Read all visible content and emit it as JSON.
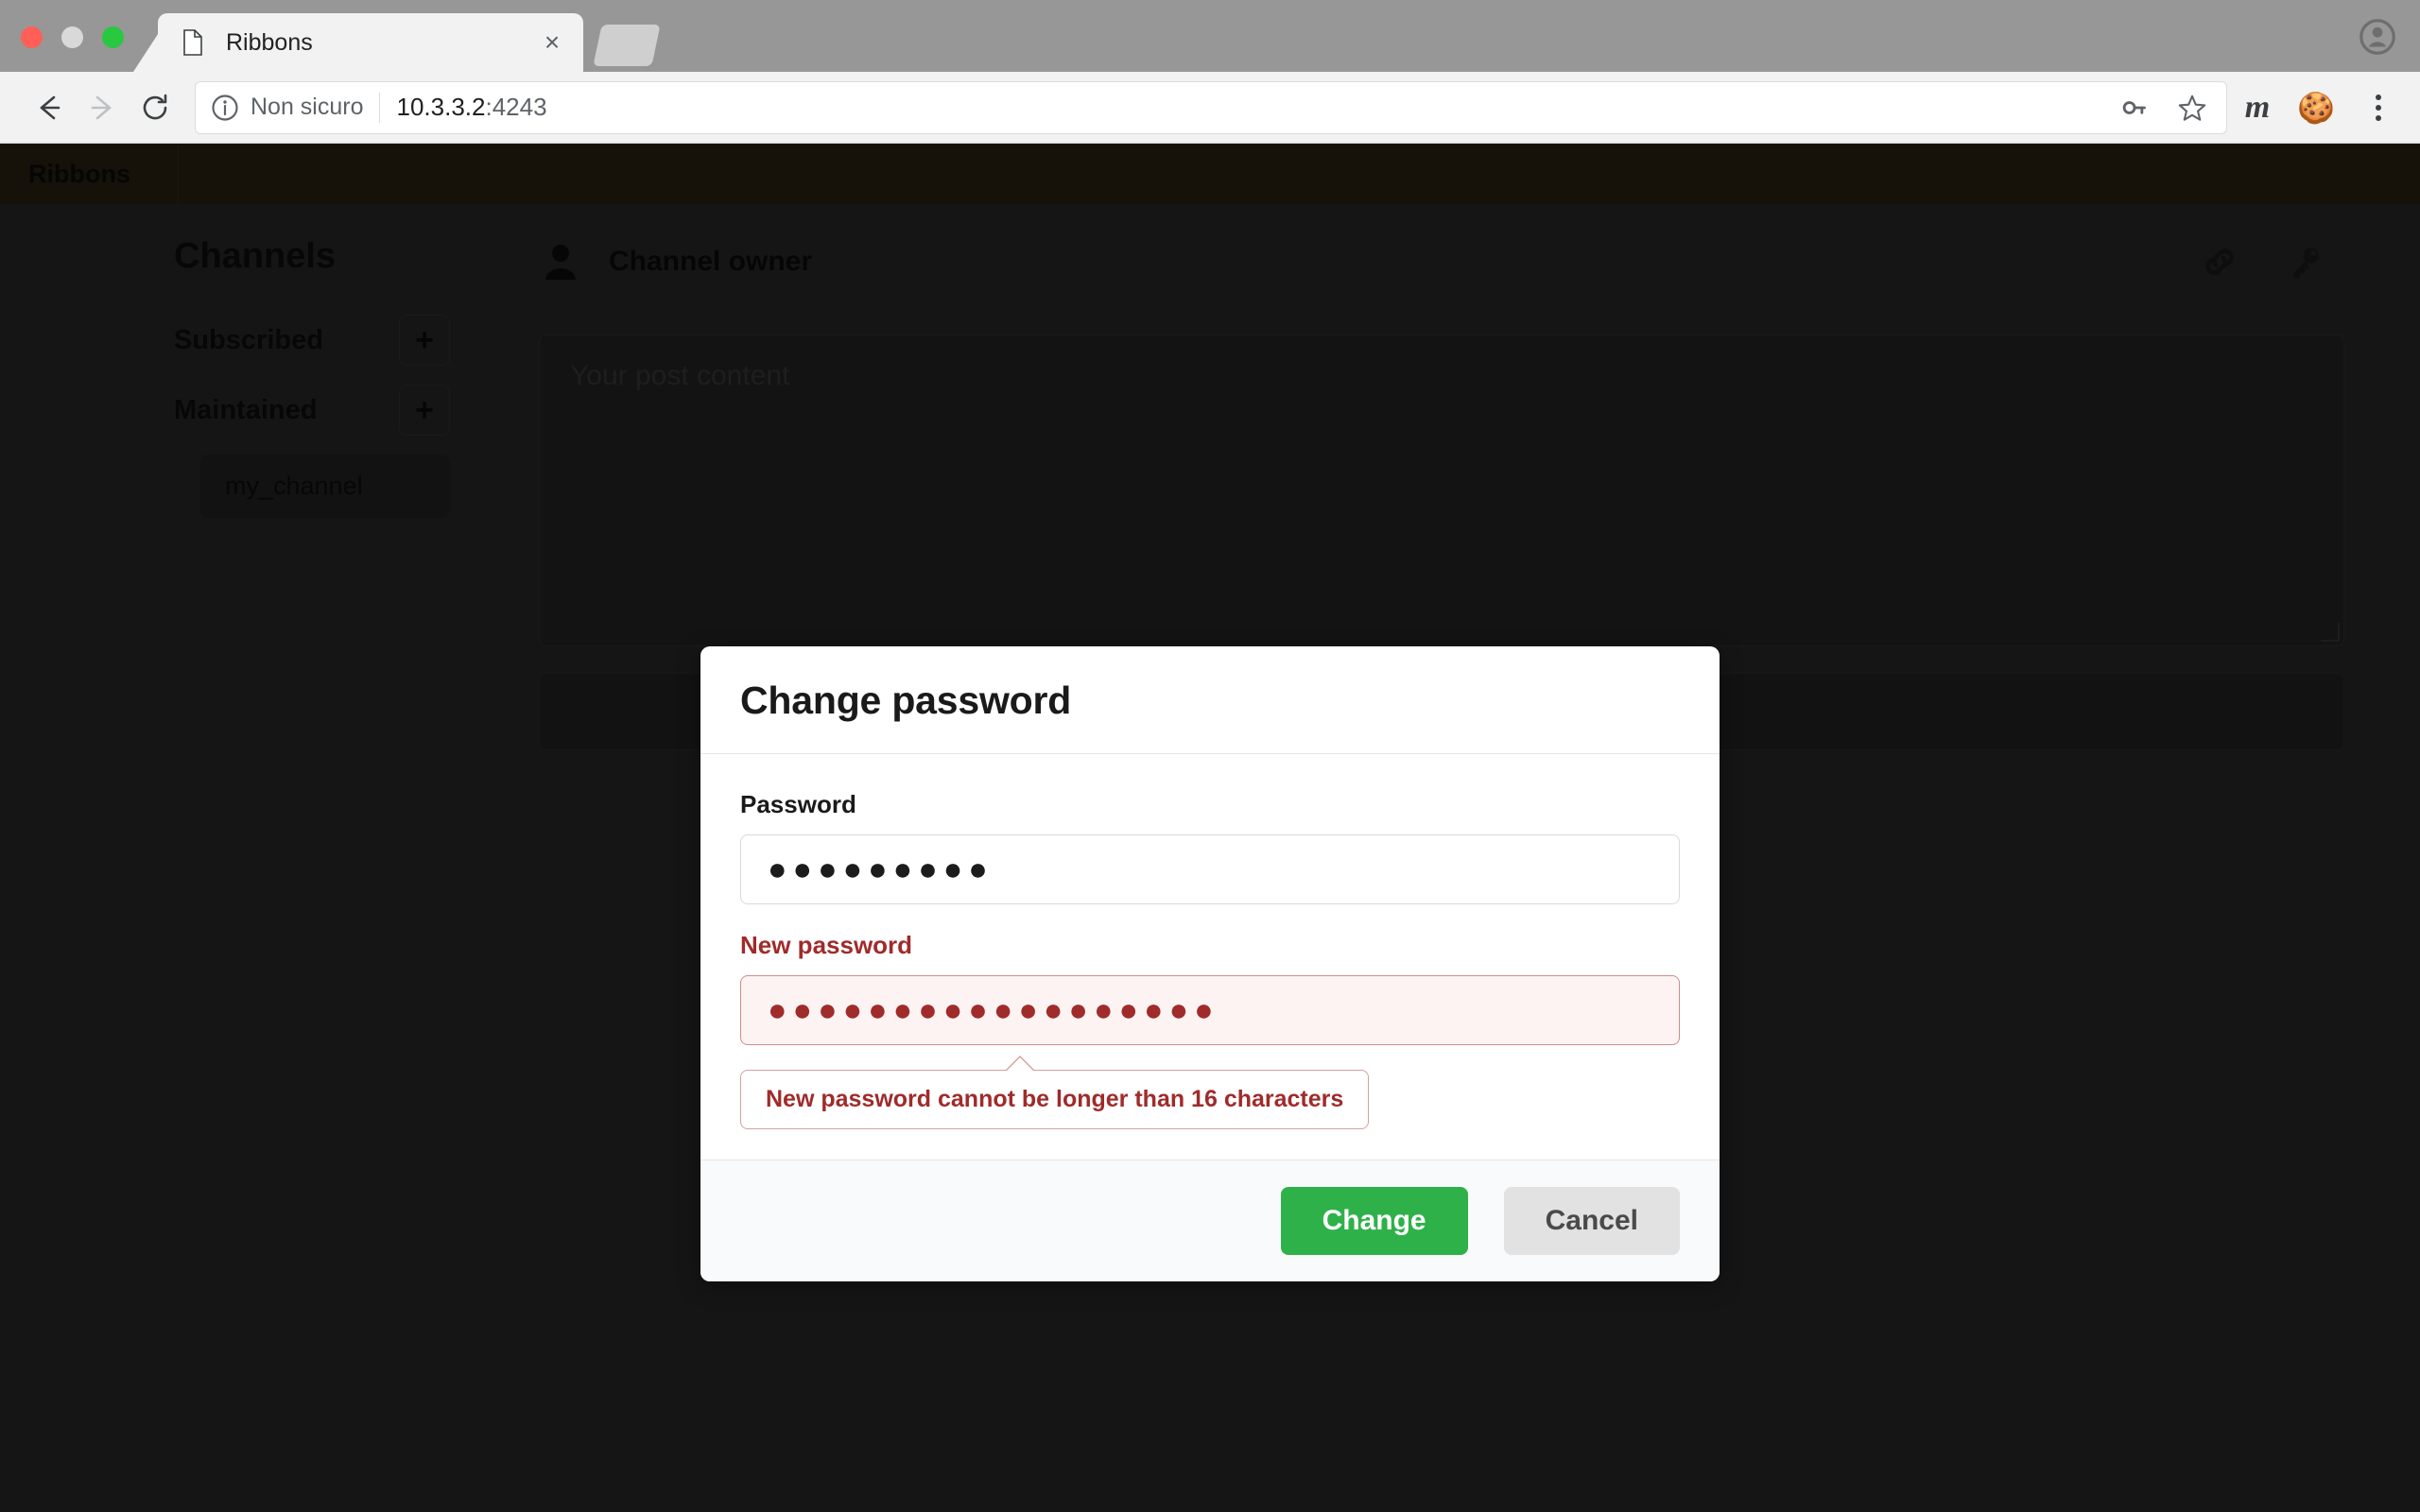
{
  "browser": {
    "tab": {
      "title": "Ribbons",
      "favicon": "document-icon",
      "close": "×"
    },
    "newtab_label": "+",
    "profile_icon": "profile-avatar-icon",
    "toolbar": {
      "back_icon": "back-arrow-icon",
      "forward_icon": "forward-arrow-icon",
      "reload_icon": "reload-icon",
      "security_label": "Non sicuro",
      "security_icon": "info-circle-icon",
      "url_host": "10.3.3.2",
      "url_port": ":4243",
      "url_full": "10.3.3.2:4243",
      "password_icon": "key-icon",
      "bookmark_icon": "star-icon",
      "ext_m_label": "m",
      "ext_cookie_glyph": "🍪",
      "menu_icon": "three-dot-menu-icon"
    }
  },
  "app": {
    "brand": "Ribbons",
    "sidebar": {
      "title": "Channels",
      "groups": [
        {
          "label": "Subscribed",
          "add_label": "+"
        },
        {
          "label": "Maintained",
          "add_label": "+"
        }
      ],
      "channels": [
        "my_channel"
      ]
    },
    "content": {
      "owner_label": "Channel owner",
      "owner_icon": "user-icon",
      "link_icon": "link-icon",
      "key_icon": "key-icon",
      "post_placeholder": "Your post content"
    }
  },
  "modal": {
    "title": "Change password",
    "fields": [
      {
        "label": "Password",
        "value_masked": "●●●●●●●●●",
        "char_count": 9,
        "has_error": false
      },
      {
        "label": "New password",
        "value_masked": "●●●●●●●●●●●●●●●●●●",
        "char_count": 18,
        "has_error": true
      }
    ],
    "error_message": "New password cannot be longer than 16 characters",
    "confirm_label": "Change",
    "cancel_label": "Cancel",
    "colors": {
      "confirm_bg": "#2fb14a",
      "cancel_bg": "#e2e2e2",
      "error_text": "#a02b2b",
      "error_field_bg": "#fdf3f3"
    }
  }
}
